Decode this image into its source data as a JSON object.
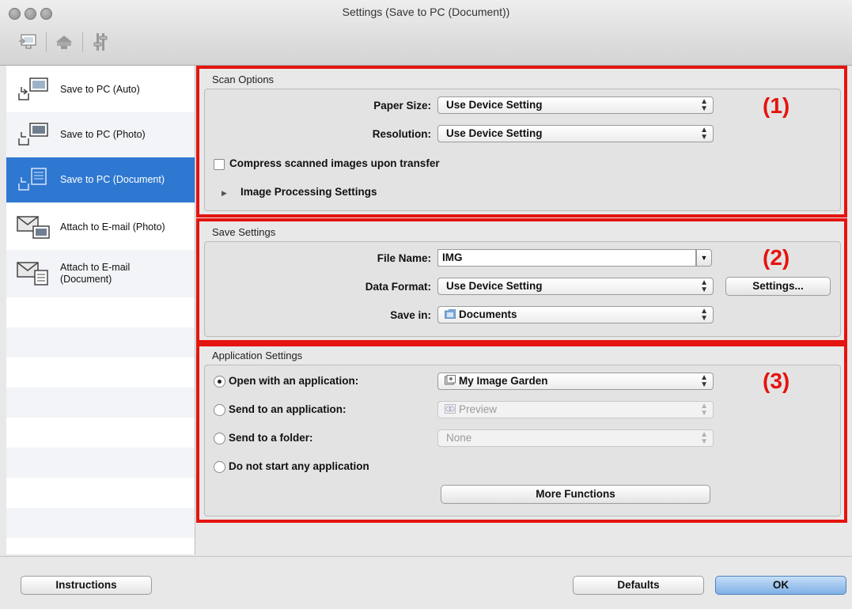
{
  "window": {
    "title": "Settings (Save to PC (Document))"
  },
  "sidebar": {
    "items": [
      {
        "label": "Save to PC (Auto)"
      },
      {
        "label": "Save to PC (Photo)"
      },
      {
        "label": "Save to PC (Document)"
      },
      {
        "label": "Attach to E-mail (Photo)"
      },
      {
        "label": "Attach to E-mail (Document)",
        "line1": "Attach to E-mail",
        "line2": "(Document)"
      }
    ],
    "selected_index": 2
  },
  "scan_options": {
    "title": "Scan Options",
    "marker": "(1)",
    "paper_size_label": "Paper Size:",
    "paper_size_value": "Use Device Setting",
    "resolution_label": "Resolution:",
    "resolution_value": "Use Device Setting",
    "compress_label": "Compress scanned images upon transfer",
    "compress_checked": false,
    "image_processing_label": "Image Processing Settings"
  },
  "save_settings": {
    "title": "Save Settings",
    "marker": "(2)",
    "file_name_label": "File Name:",
    "file_name_value": "IMG",
    "data_format_label": "Data Format:",
    "data_format_value": "Use Device Setting",
    "settings_button": "Settings...",
    "save_in_label": "Save in:",
    "save_in_value": "Documents"
  },
  "application_settings": {
    "title": "Application Settings",
    "marker": "(3)",
    "options": [
      {
        "label": "Open with an application:",
        "value": "My Image Garden",
        "selected": true,
        "enabled": true
      },
      {
        "label": "Send to an application:",
        "value": "Preview",
        "selected": false,
        "enabled": false
      },
      {
        "label": "Send to a folder:",
        "value": "None",
        "selected": false,
        "enabled": false
      },
      {
        "label": "Do not start any application",
        "selected": false
      }
    ],
    "more_functions_button": "More Functions"
  },
  "footer": {
    "instructions_button": "Instructions",
    "defaults_button": "Defaults",
    "ok_button": "OK"
  },
  "colors": {
    "accent": "#2f78d1",
    "highlight_red": "#e41410"
  }
}
